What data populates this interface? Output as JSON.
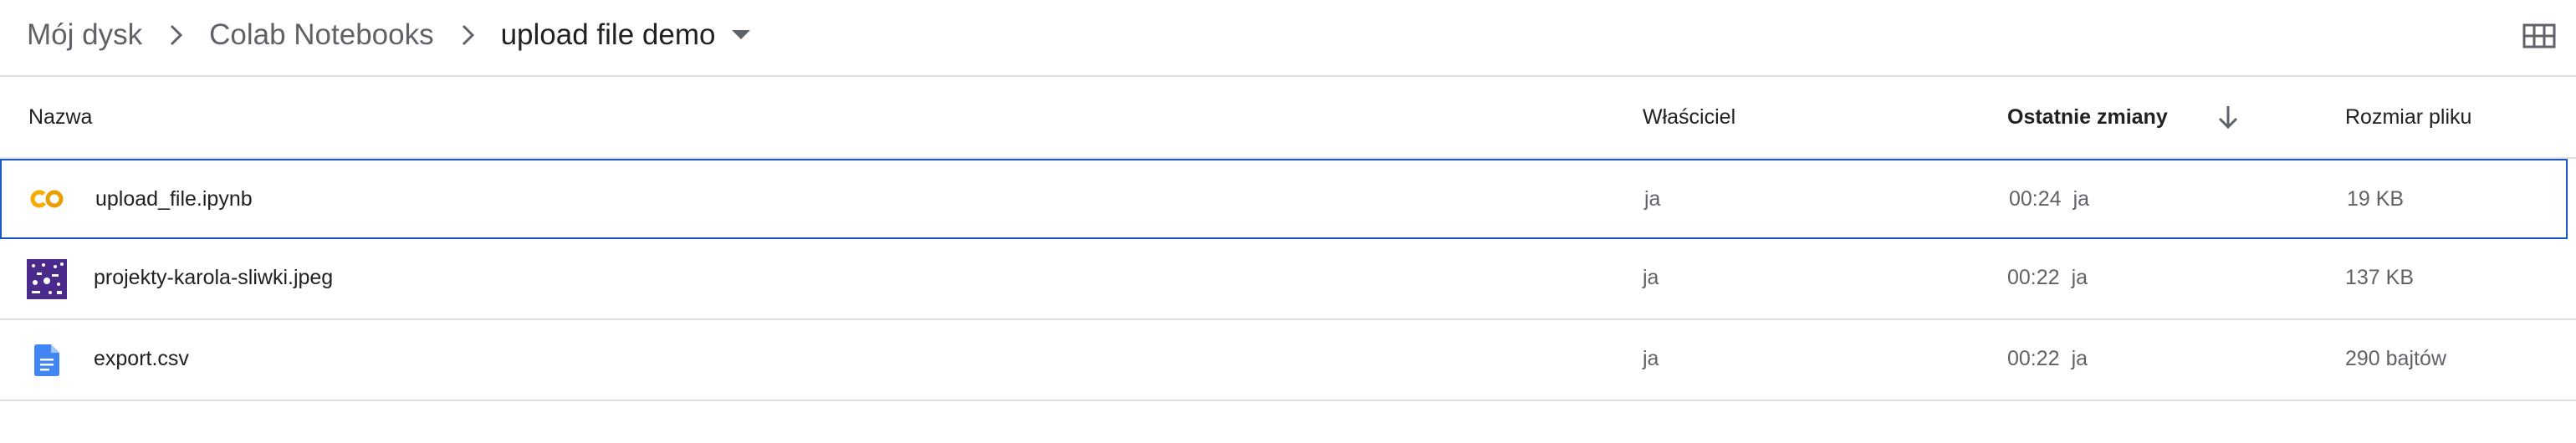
{
  "breadcrumb": {
    "items": [
      "Mój dysk",
      "Colab Notebooks",
      "upload file demo"
    ]
  },
  "table": {
    "headers": {
      "name": "Nazwa",
      "owner": "Właściciel",
      "modified": "Ostatnie zmiany",
      "size": "Rozmiar pliku"
    },
    "sort": {
      "column": "modified",
      "direction": "descending",
      "icon": "arrow-down-icon"
    },
    "rows": [
      {
        "icon": "colab-icon",
        "name": "upload_file.ipynb",
        "owner": "ja",
        "modified_time": "00:24",
        "modified_by": "ja",
        "size": "19 KB",
        "selected": true
      },
      {
        "icon": "image-thumbnail-icon",
        "name": "projekty-karola-sliwki.jpeg",
        "owner": "ja",
        "modified_time": "00:22",
        "modified_by": "ja",
        "size": "137 KB",
        "selected": false
      },
      {
        "icon": "google-docs-icon",
        "name": "export.csv",
        "owner": "ja",
        "modified_time": "00:22",
        "modified_by": "ja",
        "size": "290 bajtów",
        "selected": false
      }
    ]
  },
  "colors": {
    "selected_border": "#1a56c4",
    "colab_orange": "#f9ab00",
    "docs_blue": "#4285f4",
    "thumbnail_purple": "#4a2a8a"
  },
  "icons": {
    "chevron": "chevron-right-icon",
    "dropdown": "caret-down-icon",
    "grid_view": "grid-view-icon"
  }
}
